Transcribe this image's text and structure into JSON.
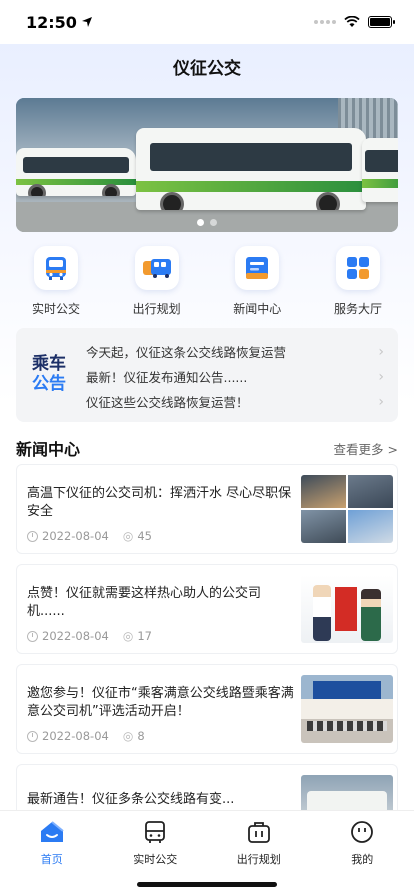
{
  "status_bar": {
    "time": "12:50",
    "icons": [
      "location-arrow-icon",
      "signal-icon",
      "wifi-icon",
      "battery-icon"
    ]
  },
  "nav": {
    "title": "仪征公交"
  },
  "banner": {
    "page_count": 2,
    "active_page": 1
  },
  "quick_actions": [
    {
      "label": "实时公交",
      "icon": "bus-icon"
    },
    {
      "label": "出行规划",
      "icon": "route-icon"
    },
    {
      "label": "新闻中心",
      "icon": "news-icon"
    },
    {
      "label": "服务大厅",
      "icon": "grid-icon"
    }
  ],
  "notice": {
    "logo_line1": "乘车",
    "logo_line2": "公告",
    "items": [
      "今天起，仪征这条公交线路恢复运营",
      "最新！仪征发布通知公告......",
      "仪征这些公交线路恢复运营！"
    ]
  },
  "news": {
    "title": "新闻中心",
    "more": "查看更多 >",
    "items": [
      {
        "title": "高温下仪征的公交司机：挥洒汗水 尽心尽职保安全",
        "date": "2022-08-04",
        "views": "45"
      },
      {
        "title": "点赞！仪征就需要这样热心助人的公交司机......",
        "date": "2022-08-04",
        "views": "17"
      },
      {
        "title": "邀您参与！仪征市“乘客满意公交线路暨乘客满意公交司机”评选活动开启！",
        "date": "2022-08-04",
        "views": "8"
      },
      {
        "title": "最新通告！仪征多条公交线路有变...",
        "date": "",
        "views": ""
      }
    ]
  },
  "tabbar": {
    "items": [
      {
        "label": "首页",
        "icon": "home-icon",
        "active": true
      },
      {
        "label": "实时公交",
        "icon": "bus-icon",
        "active": false
      },
      {
        "label": "出行规划",
        "icon": "briefcase-icon",
        "active": false
      },
      {
        "label": "我的",
        "icon": "profile-icon",
        "active": false
      }
    ]
  },
  "colors": {
    "accent": "#2b7bf3",
    "notice_dark": "#1c2f67"
  }
}
